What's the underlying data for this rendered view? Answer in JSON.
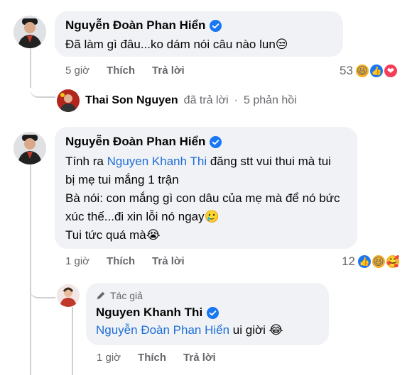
{
  "comments": [
    {
      "author": "Nguyễn Đoàn Phan Hiển",
      "text": "Đã làm gì đâu...ko dám nói câu nào lun",
      "emoji": "😒",
      "time": "5 giờ",
      "like": "Thích",
      "reply": "Trả lời",
      "reaction_count": "53"
    },
    {
      "author": "Nguyễn Đoàn Phan Hiển",
      "mention": "Nguyen Khanh Thi",
      "line1_rest": " đăng stt vui thui mà tui",
      "line1_pre": "Tính ra ",
      "line2": "bị mẹ tui mắng 1 trận",
      "line3": "Bà nói: con mắng gì con dâu của mẹ mà để nó bức",
      "line4": "xúc thế...đi xin lỗi nó ngay",
      "line4_emoji": "🥲",
      "line5": "Tui tức quá mà",
      "line5_emoji": "😭",
      "time": "1 giờ",
      "like": "Thích",
      "reply": "Trả lời",
      "reaction_count": "12"
    }
  ],
  "reply_summary": {
    "name": "Thai Son Nguyen",
    "action": "đã trả lời",
    "separator": "·",
    "count": "5 phản hồi"
  },
  "reply": {
    "tag": "Tác giả",
    "author": "Nguyen Khanh Thi",
    "mention": "Nguyễn Đoàn Phan Hiển",
    "text": " ui giời",
    "emoji": "😂",
    "time": "1 giờ",
    "like": "Thích",
    "reply": "Trả lời"
  },
  "colors": {
    "verified": "#1877f2",
    "mention": "#1e6ed8",
    "bubble": "#f0f2f5",
    "meta": "#65676b"
  }
}
